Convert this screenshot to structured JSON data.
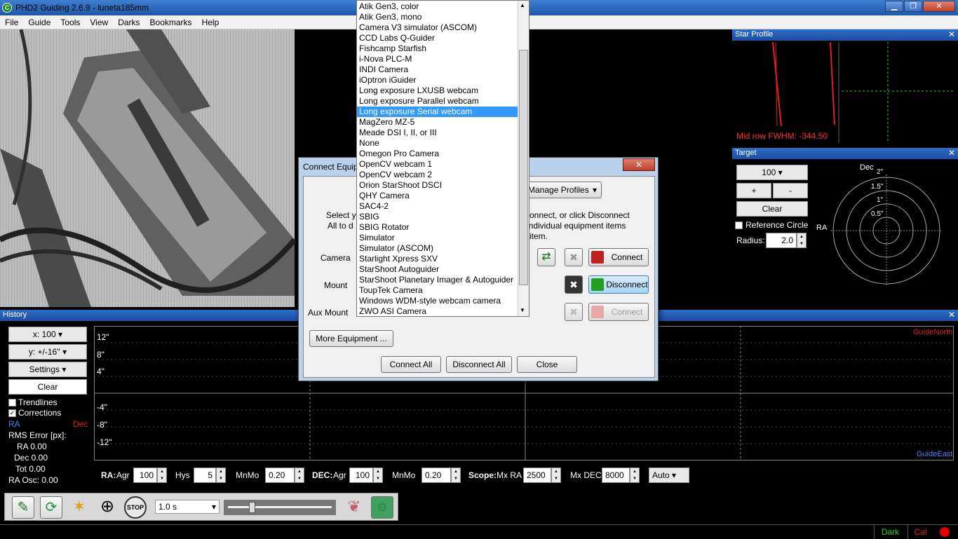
{
  "window": {
    "title": "PHD2 Guiding 2.6.9 - luneta185mm",
    "app_icon": "phd2-icon",
    "min": "▁",
    "max": "❐",
    "close": "✕"
  },
  "menu": [
    "File",
    "Guide",
    "Tools",
    "View",
    "Darks",
    "Bookmarks",
    "Help"
  ],
  "star_profile": {
    "title": "Star Profile",
    "fwhm": "Mid row FWHM: -344.50",
    "close": "✕"
  },
  "target": {
    "title": "Target",
    "zoom": "100",
    "plus": "+",
    "minus": "-",
    "clear": "Clear",
    "ref_circle": "Reference Circle",
    "radius_label": "Radius:",
    "radius": "2.0",
    "dec": "Dec",
    "ra": "RA",
    "rings": [
      "2\"",
      "1.5\"",
      "1\"",
      "0.5\""
    ],
    "close": "✕"
  },
  "history": {
    "title": "History",
    "xscale": "x: 100",
    "yscale": "y: +/-16''",
    "settings": "Settings",
    "clear": "Clear",
    "trendlines": "Trendlines",
    "corrections": "Corrections",
    "ra": "RA",
    "dec": "Dec",
    "rms_label": "RMS Error [px]:",
    "ra_val": "RA 0.00",
    "dec_val": "Dec 0.00",
    "tot_val": "Tot 0.00",
    "ra_osc": "RA Osc: 0.00",
    "y_ticks": [
      "12\"",
      "8\"",
      "4\"",
      "-4\"",
      "-8\"",
      "-12\""
    ],
    "guide_north": "GuideNorth",
    "guide_east": "GuideEast",
    "close": "✕"
  },
  "params": {
    "ra_label": "RA:",
    "agr": "Agr",
    "ra_agr": "100",
    "hys": "Hys",
    "hys_val": "5",
    "mnmo": "MnMo",
    "ra_mnmo": "0.20",
    "dec_label": "DEC:",
    "dec_agr": "100",
    "dec_mnmo": "0.20",
    "scope_label": "Scope:",
    "mxra": "Mx RA",
    "mxra_val": "2500",
    "mxdec": "Mx DEC",
    "mxdec_val": "8000",
    "mode": "Auto"
  },
  "toolbar": {
    "exposure": "1.0 s"
  },
  "status": {
    "dark": "Dark",
    "cal": "Cal"
  },
  "dialog": {
    "title": "Connect Equip",
    "close": "✕",
    "manage_profiles": "Manage Profiles",
    "instr_left1": "Select y",
    "instr_left2": "All to d",
    "instr_right1": "connect, or click Disconnect",
    "instr_right2": "individual equipment items",
    "instr_right3": "item.",
    "camera": "Camera",
    "mount": "Mount",
    "aux_mount": "Aux Mount",
    "connect": "Connect",
    "disconnect": "Disconnect",
    "connect_aux": "Connect",
    "more_equipment": "More Equipment ...",
    "connect_all": "Connect All",
    "disconnect_all": "Disconnect All",
    "close_btn": "Close"
  },
  "camera_list": {
    "items": [
      "Atik Gen3, color",
      "Atik Gen3, mono",
      "Camera V3 simulator (ASCOM)",
      "CCD Labs Q-Guider",
      "Fishcamp Starfish",
      "i-Nova PLC-M",
      "INDI Camera",
      "iOptron iGuider",
      "Long exposure LXUSB webcam",
      "Long exposure Parallel webcam",
      "Long exposure Serial webcam",
      "MagZero MZ-5",
      "Meade DSI I, II, or III",
      "None",
      "Omegon Pro Camera",
      "OpenCV webcam 1",
      "OpenCV webcam 2",
      "Orion StarShoot DSCI",
      "QHY Camera",
      "SAC4-2",
      "SBIG",
      "SBIG Rotator",
      "Simulator",
      "Simulator (ASCOM)",
      "Starlight Xpress SXV",
      "StarShoot Autoguider",
      "StarShoot Planetary Imager & Autoguider",
      "ToupTek Camera",
      "Windows WDM-style webcam camera",
      "ZWO ASI Camera"
    ],
    "selected": "Long exposure Serial webcam"
  },
  "colors": {
    "accent": "#3399ff",
    "fwhm": "#ff3030",
    "crosshair": "#40c040"
  }
}
